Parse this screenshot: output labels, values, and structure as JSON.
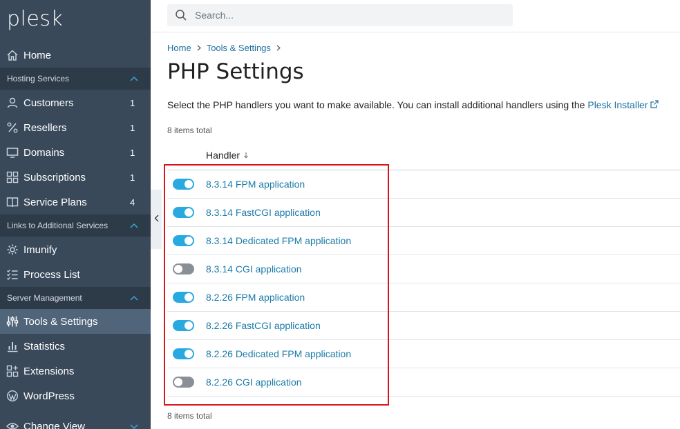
{
  "sidebar": {
    "logo": "plesk",
    "home": "Home",
    "sections": {
      "hosting": "Hosting Services",
      "links": "Links to Additional Services",
      "server": "Server Management"
    },
    "hosting_items": [
      {
        "label": "Customers",
        "count": "1"
      },
      {
        "label": "Resellers",
        "count": "1"
      },
      {
        "label": "Domains",
        "count": "1"
      },
      {
        "label": "Subscriptions",
        "count": "1"
      },
      {
        "label": "Service Plans",
        "count": "4"
      }
    ],
    "link_items": [
      {
        "label": "Imunify"
      },
      {
        "label": "Process List"
      }
    ],
    "server_items": [
      {
        "label": "Tools & Settings"
      },
      {
        "label": "Statistics"
      },
      {
        "label": "Extensions"
      },
      {
        "label": "WordPress"
      }
    ],
    "change_view": "Change View"
  },
  "search": {
    "placeholder": "Search..."
  },
  "breadcrumb": [
    "Home",
    "Tools & Settings"
  ],
  "page": {
    "title": "PHP Settings",
    "description": "Select the PHP handlers you want to make available. You can install additional handlers using the ",
    "installer_link": "Plesk Installer",
    "total_top": "8 items total",
    "total_bottom": "8 items total",
    "column_header": "Handler"
  },
  "handlers": [
    {
      "label": "8.3.14 FPM application",
      "enabled": true
    },
    {
      "label": "8.3.14 FastCGI application",
      "enabled": true
    },
    {
      "label": "8.3.14 Dedicated FPM application",
      "enabled": true
    },
    {
      "label": "8.3.14 CGI application",
      "enabled": false
    },
    {
      "label": "8.2.26 FPM application",
      "enabled": true
    },
    {
      "label": "8.2.26 FastCGI application",
      "enabled": true
    },
    {
      "label": "8.2.26 Dedicated FPM application",
      "enabled": true
    },
    {
      "label": "8.2.26 CGI application",
      "enabled": false
    }
  ],
  "colors": {
    "sidebar_bg": "#39495a",
    "section_bg": "#2d3a47",
    "active_bg": "#50647a",
    "link": "#1a7aa8",
    "toggle_on": "#28a9e0",
    "toggle_off": "#8a8f95",
    "highlight": "#d8141e"
  }
}
